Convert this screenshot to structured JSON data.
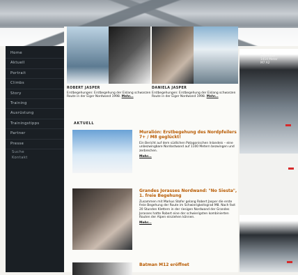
{
  "nav": {
    "items": [
      "Home",
      "Aktuell",
      "Portrait",
      "Climbs",
      "Story",
      "Training",
      "Ausrüstung",
      "Trainingstipps",
      "Partner",
      "Presse"
    ],
    "subitems": [
      "Suche",
      "Kontakt"
    ]
  },
  "photo_captions": [
    {
      "name": "ROBERT JASPER",
      "text": "Erstbegehungen: Erstbegehung der Eislang schwarzen Route in der Eiger Nordwand 1998.",
      "more": "Mehr..."
    },
    {
      "name": "DANIELA JASPER",
      "text": "Erstbegehungen: Erstbegehung der Eislang schwarzen Route in der Eiger Nordwand 1998.",
      "more": "Mehr..."
    }
  ],
  "news": {
    "section_title": "AKTUELL",
    "items": [
      {
        "title": "Muralión: Erstbegehung des Nordpfeilers 7+ / M8 geglückt!",
        "body": "Ein Bericht auf dem südlichen Patagonischen Inlandeis – eine unbezwingbare Nordostwand auf 1100 Metern bezwingen und zerbrechen.",
        "more": "Mehr..."
      },
      {
        "title": "Grandes Jorasses Nordwand: \"No Siesta\", 1. freie Begehung",
        "body": "Zusammen mit Markus Stofer gelang Robert Jasper die erste freie Begehung der Route im Schwierigkeitsgrad M8. Nach fast 20 Stunden Klettern in der riesigen Nordwand der Grandes Jorasses hatte Robert eine der schwierigsten kombinierten Routen der Alpen einziehen können.",
        "more": "Mehr..."
      },
      {
        "title": "Batman M12 eröffnet",
        "body": "",
        "more": ""
      }
    ]
  },
  "rightcol": {
    "label": "Stallhütte\n1414 Meter\nM7 A2"
  },
  "colors": {
    "sidebar": "#1a1f24",
    "accent_title": "#b85a00",
    "marker": "#d72b2b"
  }
}
